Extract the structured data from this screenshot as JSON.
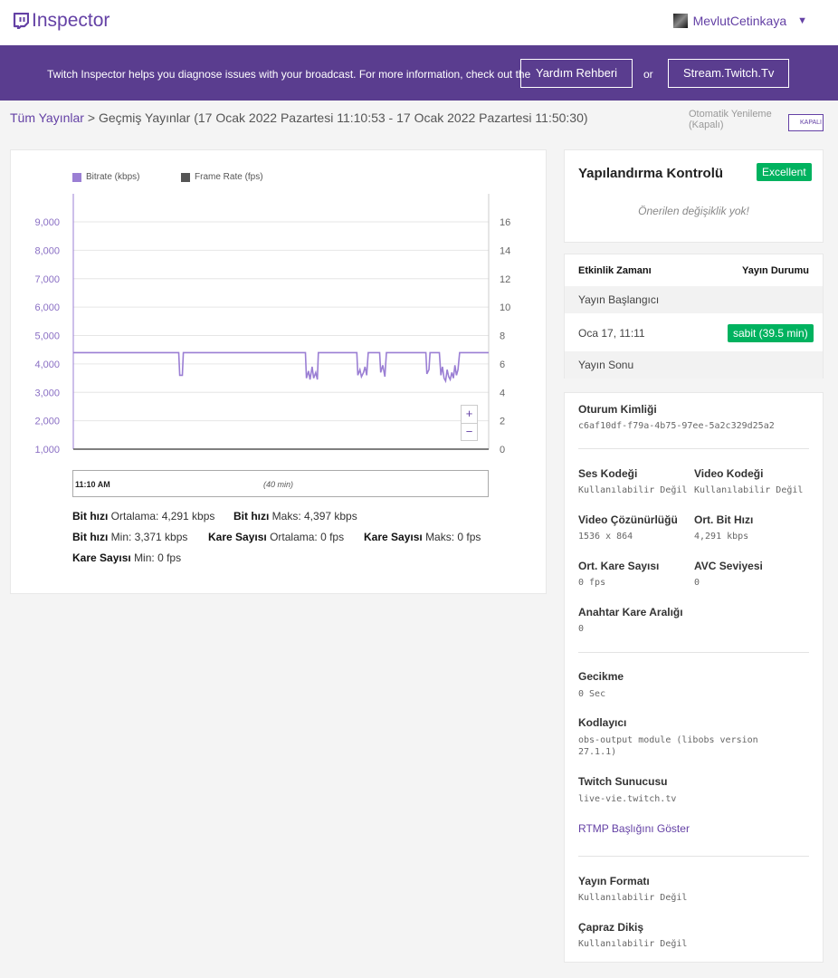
{
  "app": {
    "logo_text": "Inspector",
    "logo_icon": "twitch-glitch-icon"
  },
  "user": {
    "name": "MevlutCetinkaya",
    "caret": "▼"
  },
  "banner": {
    "text": "Twitch Inspector helps you diagnose issues with your broadcast. For more information, check out the",
    "help_button": "Yardım Rehberi",
    "or": "or",
    "site_button": "Stream.Twitch.Tv"
  },
  "breadcrumb": {
    "root": "Tüm Yayınlar",
    "separator": ">",
    "current": "Geçmiş Yayınlar (17 Ocak 2022 Pazartesi 11:10:53 - 17 Ocak 2022 Pazartesi 11:50:30)"
  },
  "autorefresh": {
    "label": "Otomatik Yenileme (Kapalı)",
    "toggle_text": "KAPALI"
  },
  "chart_data": {
    "type": "line",
    "legend": [
      "Bitrate (kbps)",
      "Frame Rate (fps)"
    ],
    "series_colors": [
      "#9b7fd4",
      "#555555"
    ],
    "y_left_ticks": [
      "9,000",
      "8,000",
      "7,000",
      "6,000",
      "5,000",
      "4,000",
      "3,000",
      "2,000",
      "1,000"
    ],
    "y_right_ticks": [
      "16",
      "14",
      "12",
      "10",
      "8",
      "6",
      "4",
      "2",
      "0"
    ],
    "ylim_left": [
      1000,
      9000
    ],
    "ylim_right": [
      0,
      16
    ],
    "x_minutes": [
      0,
      20.3,
      20.5,
      21.0,
      21.2,
      44.7,
      44.9,
      45.3,
      45.6,
      46.0,
      46.3,
      46.7,
      47.0,
      47.2,
      54.6,
      54.8,
      55.2,
      55.5,
      55.9,
      56.2,
      56.5,
      56.8,
      59.0,
      59.2,
      59.6,
      60.0,
      60.3,
      61.0,
      61.2,
      67.9,
      68.1,
      68.5,
      68.7,
      70.5,
      70.8,
      71.1,
      71.4,
      71.7,
      72.0,
      72.3,
      72.6,
      72.9,
      73.2,
      73.5,
      73.8,
      74.1,
      74.4,
      74.7,
      75.0,
      80
    ],
    "bitrate_kbps": [
      4397,
      4397,
      3600,
      3600,
      4397,
      4397,
      3500,
      3750,
      3450,
      3900,
      3500,
      3700,
      3450,
      4397,
      4397,
      3600,
      3800,
      3550,
      3700,
      3900,
      3600,
      4397,
      4397,
      3700,
      3950,
      3550,
      4397,
      4397,
      4397,
      4397,
      3650,
      3800,
      4397,
      4397,
      3600,
      3900,
      3500,
      3400,
      3800,
      3550,
      3450,
      3700,
      3500,
      3950,
      3600,
      3800,
      4397,
      4397,
      4397,
      4397
    ],
    "frame_rate_fps": [
      0,
      0
    ],
    "frame_rate_x_minutes": [
      0,
      80
    ],
    "x_start_label": "11:10 AM",
    "x_span_label": "(40 min)",
    "zoom_in": "+",
    "zoom_out": "−"
  },
  "stats": {
    "bitrate_avg_label": "Bit hızı",
    "bitrate_avg_text": "Ortalama: 4,291 kbps",
    "bitrate_max_label": "Bit hızı",
    "bitrate_max_text": "Maks: 4,397 kbps",
    "bitrate_min_label": "Bit hızı",
    "bitrate_min_text": "Min: 3,371 kbps",
    "fps_avg_label": "Kare Sayısı",
    "fps_avg_text": "Ortalama: 0 fps",
    "fps_max_label": "Kare Sayısı",
    "fps_max_text": "Maks: 0 fps",
    "fps_min_label": "Kare Sayısı",
    "fps_min_text": "Min: 0 fps"
  },
  "config_check": {
    "title": "Yapılandırma Kontrolü",
    "badge": "Excellent",
    "message": "Önerilen değişiklik yok!"
  },
  "events": {
    "col_time": "Etkinlik Zamanı",
    "col_status": "Yayın Durumu",
    "start_label": "Yayın Başlangıcı",
    "start_time": "Oca 17, 11:11",
    "status_badge": "sabit (39.5 min)",
    "end_label": "Yayın Sonu"
  },
  "session": {
    "id_label": "Oturum Kimliği",
    "id_value": "c6af10df-f79a-4b75-97ee-5a2c329d25a2",
    "audio_codec_label": "Ses Kodeği",
    "audio_codec_value": "Kullanılabilir Değil",
    "video_codec_label": "Video Kodeği",
    "video_codec_value": "Kullanılabilir Değil",
    "resolution_label": "Video Çözünürlüğü",
    "resolution_value": "1536 x 864",
    "avg_bitrate_label": "Ort. Bit Hızı",
    "avg_bitrate_value": "4,291 kbps",
    "avg_fps_label": "Ort. Kare Sayısı",
    "avg_fps_value": "0 fps",
    "avc_label": "AVC Seviyesi",
    "avc_value": "0",
    "keyframe_label": "Anahtar Kare Aralığı",
    "keyframe_value": "0",
    "latency_label": "Gecikme",
    "latency_value": "0 Sec",
    "encoder_label": "Kodlayıcı",
    "encoder_value": "obs-output module (libobs version 27.1.1)",
    "server_label": "Twitch Sunucusu",
    "server_value": "live-vie.twitch.tv",
    "rtmp_link": "RTMP Başlığını Göster",
    "format_label": "Yayın Formatı",
    "format_value": "Kullanılabilir Değil",
    "interlace_label": "Çapraz Dikiş",
    "interlace_value": "Kullanılabilir Değil"
  }
}
